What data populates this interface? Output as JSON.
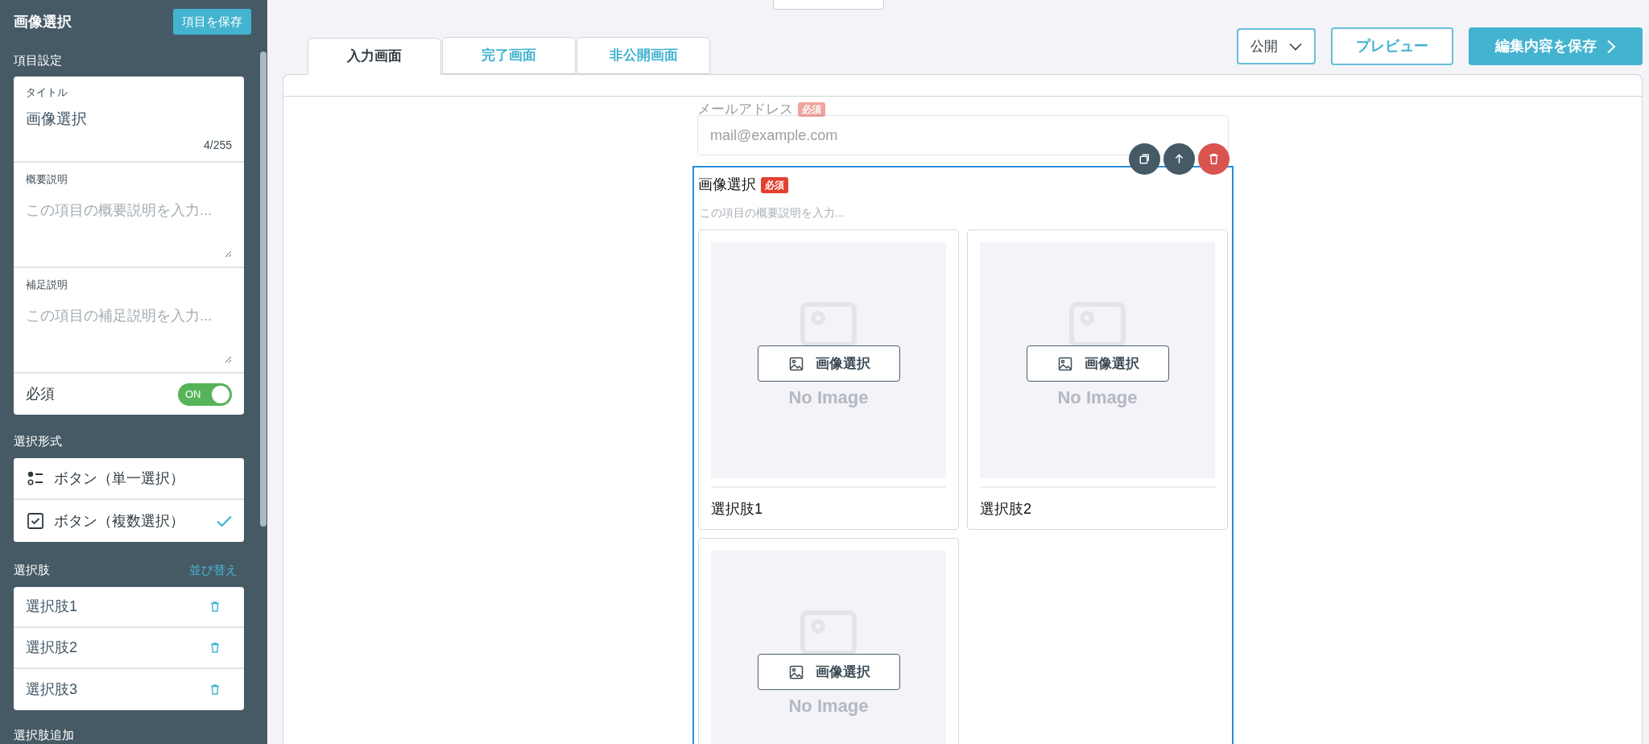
{
  "sidebar": {
    "title": "画像選択",
    "save_button": "項目を保存",
    "item_settings": {
      "heading": "項目設定",
      "title_field": {
        "label": "タイトル",
        "value": "画像選択",
        "counter": "4/255"
      },
      "summary_field": {
        "label": "概要説明",
        "placeholder": "この項目の概要説明を入力..."
      },
      "note_field": {
        "label": "補足説明",
        "placeholder": "この項目の補足説明を入力..."
      },
      "required": {
        "label": "必須",
        "on": true,
        "toggle_text": "ON"
      }
    },
    "selection_format": {
      "heading": "選択形式",
      "options": [
        {
          "kind": "radio",
          "label": "ボタン（単一選択）",
          "selected": false
        },
        {
          "kind": "checkbox",
          "label": "ボタン（複数選択）",
          "selected": true
        }
      ]
    },
    "choices": {
      "heading": "選択肢",
      "sort_link": "並び替え",
      "items": [
        "選択肢1",
        "選択肢2",
        "選択肢3"
      ]
    },
    "add_choice_heading": "選択肢追加"
  },
  "tabs": [
    {
      "label": "入力画面",
      "selected": true
    },
    {
      "label": "完了画面",
      "selected": false
    },
    {
      "label": "非公開画面",
      "selected": false
    }
  ],
  "toolbar": {
    "visibility": "公開",
    "preview": "プレビュー",
    "save": "編集内容を保存"
  },
  "form": {
    "email_field": {
      "label": "メールアドレス",
      "badge": "必須",
      "placeholder": "mail@example.com"
    },
    "image_question": {
      "title": "画像選択",
      "badge": "必須",
      "description_placeholder": "この項目の概要説明を入力...",
      "options": [
        {
          "label": "選択肢1",
          "button": "画像選択",
          "no_image": "No Image"
        },
        {
          "label": "選択肢2",
          "button": "画像選択",
          "no_image": "No Image"
        },
        {
          "button": "画像選択",
          "no_image": "No Image"
        }
      ]
    }
  }
}
